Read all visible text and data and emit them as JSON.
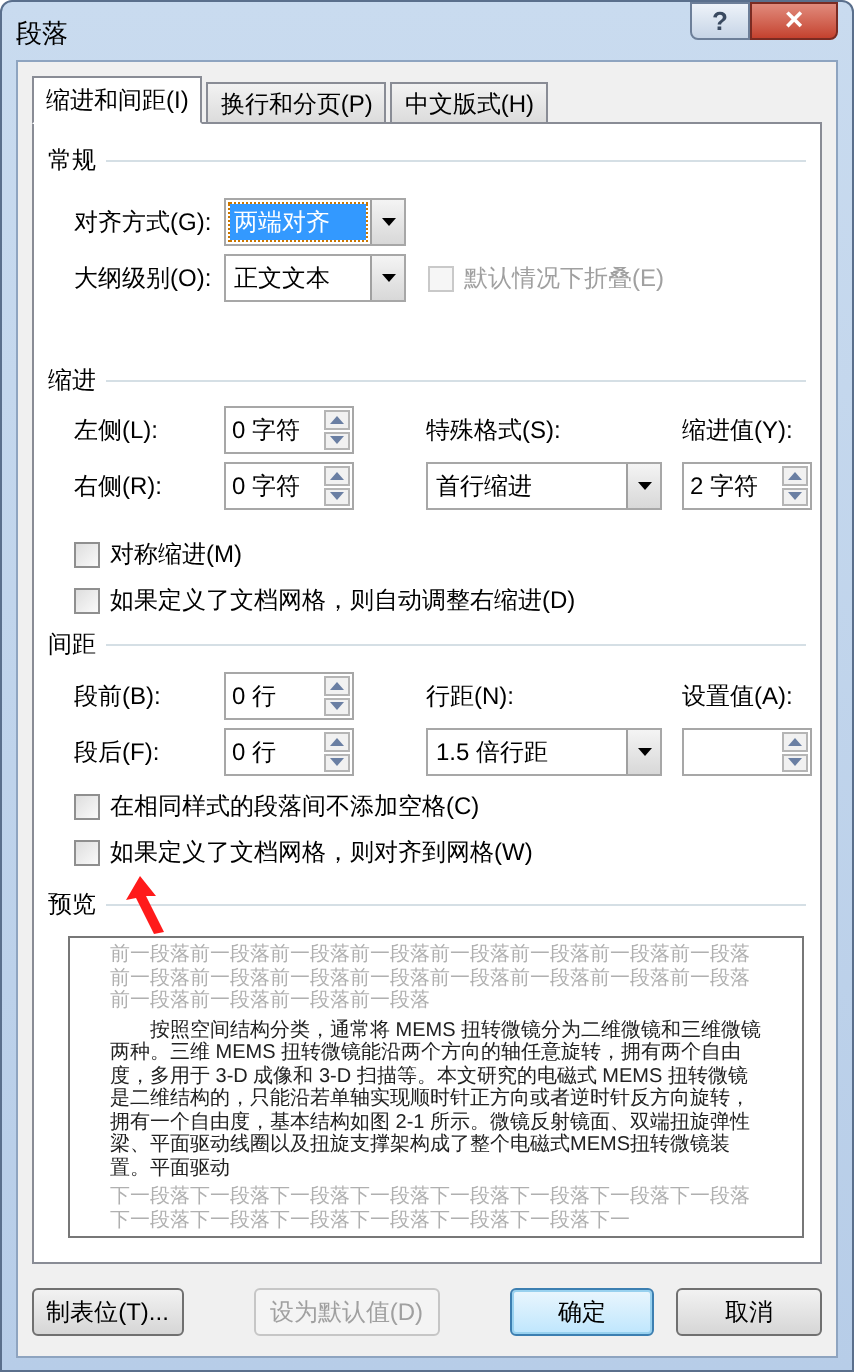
{
  "window": {
    "title": "段落",
    "help": "?",
    "close": "×"
  },
  "tabs": [
    {
      "label": "缩进和间距(I)",
      "selected": true
    },
    {
      "label": "换行和分页(P)",
      "selected": false
    },
    {
      "label": "中文版式(H)",
      "selected": false
    }
  ],
  "general": {
    "heading": "常规",
    "alignment": {
      "label": "对齐方式(G):",
      "value": "两端对齐",
      "highlighted": true
    },
    "outline_level": {
      "label": "大纲级别(O):",
      "value": "正文文本",
      "highlighted": false
    },
    "collapse": {
      "label": "默认情况下折叠(E)",
      "checked": false,
      "disabled": true
    }
  },
  "indent": {
    "heading": "缩进",
    "left": {
      "label": "左侧(L):",
      "value": "0 字符"
    },
    "right": {
      "label": "右侧(R):",
      "value": "0 字符"
    },
    "special": {
      "label": "特殊格式(S):",
      "value": "首行缩进"
    },
    "by": {
      "label": "缩进值(Y):",
      "value": "2 字符"
    },
    "checkboxes": [
      {
        "label": "对称缩进(M)",
        "checked": false,
        "disabled": false
      },
      {
        "label": "如果定义了文档网格，则自动调整右缩进(D)",
        "checked": false,
        "disabled": false
      }
    ]
  },
  "spacing": {
    "heading": "间距",
    "before": {
      "label": "段前(B):",
      "value": "0 行"
    },
    "after": {
      "label": "段后(F):",
      "value": "0 行"
    },
    "line_spacing": {
      "label": "行距(N):",
      "value": "1.5 倍行距"
    },
    "at": {
      "label": "设置值(A):"
    },
    "checkboxes": [
      {
        "label": "在相同样式的段落间不添加空格(C)",
        "checked": false,
        "disabled": false
      },
      {
        "label": "如果定义了文档网格，则对齐到网格(W)",
        "checked": false,
        "disabled": false
      }
    ]
  },
  "preview": {
    "heading": "预览",
    "previous": "前一段落前一段落前一段落前一段落前一段落前一段落前一段落前一段落前一段落前一段落前一段落前一段落前一段落前一段落前一段落前一段落前一段落前一段落前一段落前一段落",
    "paragraph": "按照空间结构分类，通常将 MEMS 扭转微镜分为二维微镜和三维微镜两种。三维 MEMS 扭转微镜能沿两个方向的轴任意旋转，拥有两个自由度，多用于 3-D 成像和 3-D 扫描等。本文研究的电磁式 MEMS 扭转微镜是二维结构的，只能沿若单轴实现顺时针正方向或者逆时针反方向旋转，拥有一个自由度，基本结构如图 2-1 所示。微镜反射镜面、双端扭旋弹性梁、平面驱动线圈以及扭旋支撑架构成了整个电磁式MEMS扭转微镜装置。平面驱动",
    "next": "下一段落下一段落下一段落下一段落下一段落下一段落下一段落下一段落下一段落下一段落下一段落下一段落下一段落下一段落下一"
  },
  "buttons": [
    {
      "label": "制表位(T)...",
      "disabled": false,
      "default": false
    },
    {
      "label": "设为默认值(D)",
      "disabled": true,
      "default": false
    },
    {
      "label": "确定",
      "disabled": false,
      "default": true
    },
    {
      "label": "取消",
      "disabled": false,
      "default": false
    }
  ]
}
